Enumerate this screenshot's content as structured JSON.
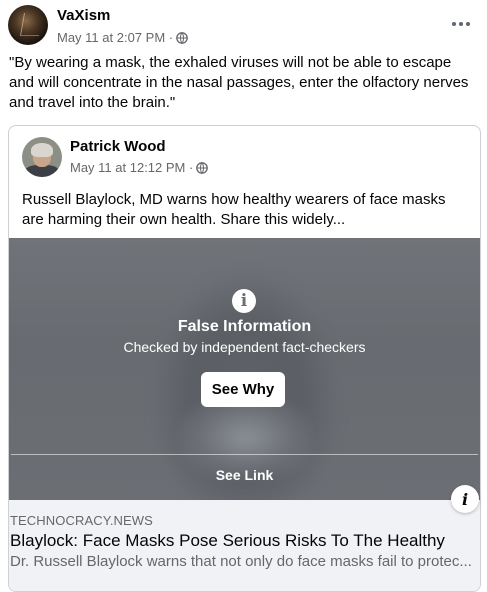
{
  "post": {
    "author": "VaXism",
    "timestamp": "May 11 at 2:07 PM ·",
    "privacy_icon": "globe-icon",
    "text": "\"By wearing a mask, the exhaled viruses will not be able to escape and will concentrate in the nasal passages, enter the olfactory nerves and travel into the brain.\""
  },
  "shared": {
    "author": "Patrick Wood",
    "timestamp": "May 11 at 12:12 PM ·",
    "privacy_icon": "globe-icon",
    "text": "Russell Blaylock, MD warns how healthy wearers of face masks are harming their own health. Share this widely..."
  },
  "overlay": {
    "icon": "info-icon",
    "title": "False Information",
    "subtitle": "Checked by independent fact-checkers",
    "button_label": "See Why",
    "link_label": "See Link"
  },
  "link": {
    "domain": "TECHNOCRACY.NEWS",
    "title": "Blaylock: Face Masks Pose Serious Risks To The Healthy",
    "description": "Dr. Russell Blaylock warns that not only do face masks fail to protec..."
  },
  "badge": {
    "label": "i"
  }
}
